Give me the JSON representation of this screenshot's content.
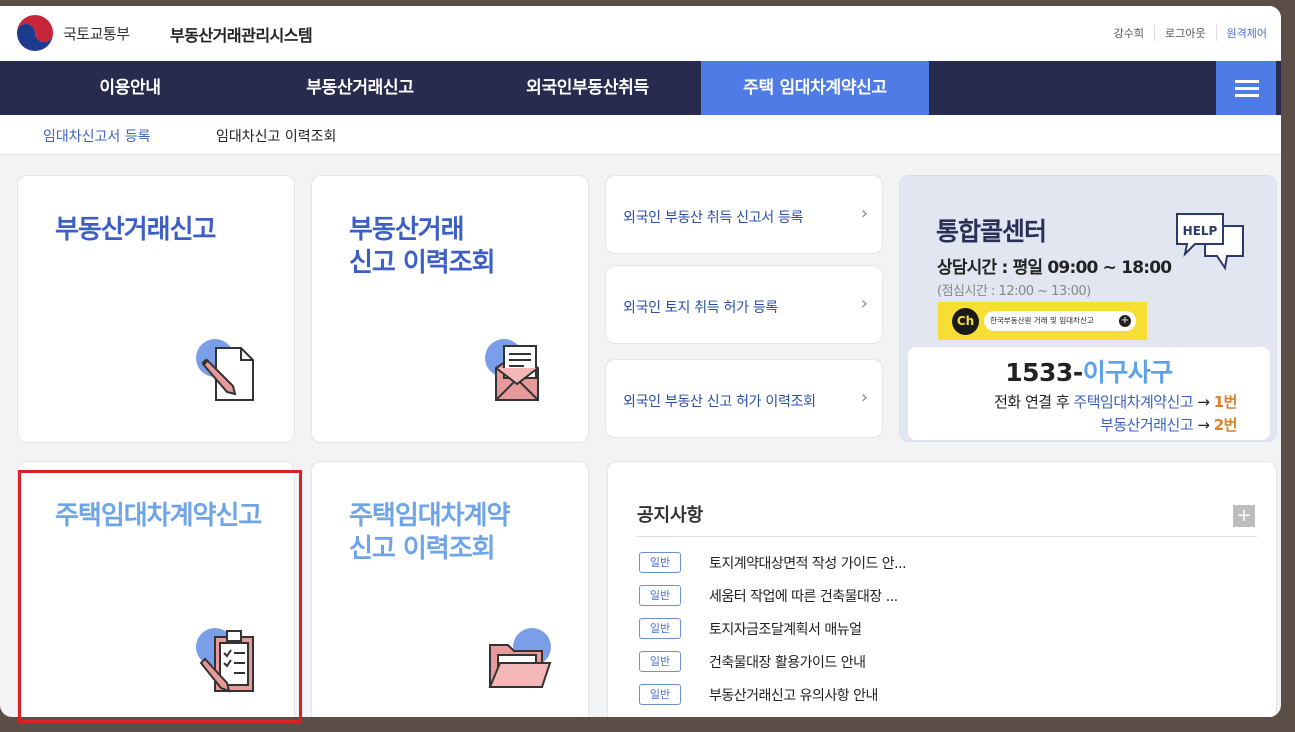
{
  "header": {
    "ministry": "국토교통부",
    "system_title": "부동산거래관리시스템",
    "util": [
      "강수희",
      "로그아웃",
      "원격제어"
    ]
  },
  "nav": {
    "items": [
      "이용안내",
      "부동산거래신고",
      "외국인부동산취득",
      "주택 임대차계약신고"
    ],
    "active": "주택 임대차계약신고",
    "menu_icon": "hamburger-icon"
  },
  "subnav": {
    "items": [
      "임대차신고서 등록",
      "임대차신고 이력조회"
    ],
    "active": "임대차신고서 등록"
  },
  "cards": {
    "real_estate_report": {
      "title": "부동산거래신고",
      "icon": "pencil-document-icon"
    },
    "real_estate_history": {
      "line1": "부동산거래",
      "line2": "신고 이력조회",
      "icon": "envelope-letter-icon"
    },
    "lease_report": {
      "title": "주택임대차계약신고",
      "icon": "clipboard-checklist-icon"
    },
    "lease_history": {
      "line1": "주택임대차계약",
      "line2": "신고 이력조회",
      "icon": "folder-open-icon"
    }
  },
  "links": [
    {
      "label": "외국인 부동산 취득 신고서 등록"
    },
    {
      "label": "외국인 토지 취득 허가 등록"
    },
    {
      "label": "외국인 부동산 신고 허가 이력조회"
    }
  ],
  "call_center": {
    "title": "통합콜센터",
    "hours": "상담시간 : 평일 09:00 ~ 18:00",
    "lunch": "(점심시간 : 12:00 ~ 13:00)",
    "kakao_badge": "Ch",
    "kakao_text": "한국부동산원 거래 및 임대차신고",
    "help_text": "HELP",
    "phone_prefix": "1533-",
    "phone_word": "이구사구",
    "route1_prefix": "전화 연결 후 ",
    "route1_target": "주택임대차계약신고",
    "route_arrow": " → ",
    "route1_num": "1번",
    "route2_target": "부동산거래신고",
    "route2_num": "2번"
  },
  "notices": {
    "title": "공지사항",
    "more": "+",
    "items": [
      {
        "badge": "일반",
        "text": "토지계약대상면적 작성 가이드 안..."
      },
      {
        "badge": "일반",
        "text": "세움터 작업에 따른 건축물대장 ..."
      },
      {
        "badge": "일반",
        "text": "토지자금조달계획서 매뉴얼"
      },
      {
        "badge": "일반",
        "text": "건축물대장 활용가이드 안내"
      },
      {
        "badge": "일반",
        "text": "부동산거래신고 유의사항 안내"
      }
    ]
  },
  "colors": {
    "nav_bg": "#272c4e",
    "accent": "#4f7be6",
    "title_blue": "#3c5fc7",
    "title_light": "#6ea4ea",
    "highlight": "#e02020"
  }
}
